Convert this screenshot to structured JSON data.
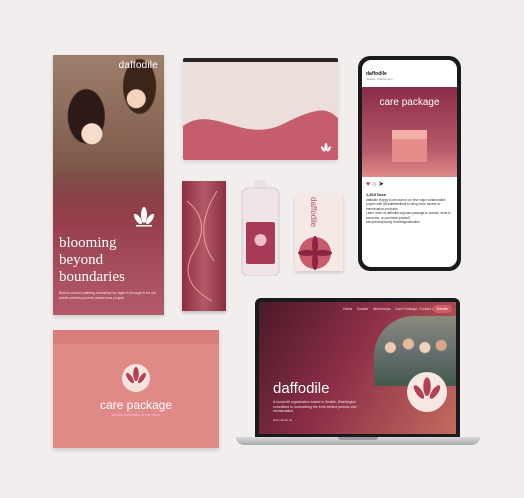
{
  "poster": {
    "brand": "daffodile",
    "headline_1": "blooming",
    "headline_2": "beyond",
    "headline_3": "boundaries",
    "subtext": "Built-in-school painting workshop for ages 8 through 8 for our whole periods poverty awareness project"
  },
  "card": {
    "text": "daffodile"
  },
  "box": {
    "title": "care package",
    "tagline": "all your essentials in one place"
  },
  "phone": {
    "account": "daffodile",
    "location": "Seattle, Washington",
    "post_title": "care package",
    "likes": "1,823 likes",
    "caption_1": "daffodile Happy to announce our first major collaborative project with @healthiewithall to bring more access to menstruation products",
    "caption_2": "Learn more at daffodile.org/care-package to donate, send to someone, or purchase yourself",
    "hashtags": "#endperiodpoverty #endstigmatization"
  },
  "laptop": {
    "nav": [
      "Home",
      "Donate",
      "Workshops",
      "Care Package",
      "Contact Us"
    ],
    "donate": "Donate",
    "brand": "daffodile",
    "description": "A nonprofit organization based in Seattle, Washington committed to normalizing the truth behind periods and menstruation.",
    "more": "learn about us"
  },
  "colors": {
    "background": "#f3eeee",
    "brand_maroon": "#8a2c48",
    "brand_pink": "#e08a87"
  }
}
